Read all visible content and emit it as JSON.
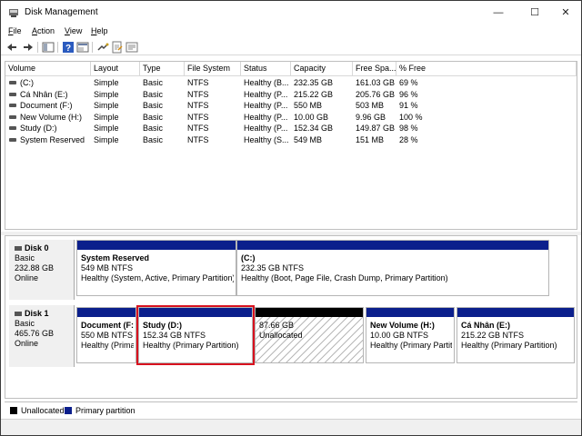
{
  "window": {
    "title": "Disk Management"
  },
  "window_controls": {
    "minimize": "—",
    "maximize": "☐",
    "close": "✕"
  },
  "menu": [
    {
      "underline": "F",
      "rest": "ile"
    },
    {
      "underline": "A",
      "rest": "ction"
    },
    {
      "underline": "V",
      "rest": "iew"
    },
    {
      "underline": "H",
      "rest": "elp"
    }
  ],
  "volumes": {
    "headers": [
      "Volume",
      "Layout",
      "Type",
      "File System",
      "Status",
      "Capacity",
      "Free Spa...",
      "% Free"
    ],
    "rows": [
      [
        "(C:)",
        "Simple",
        "Basic",
        "NTFS",
        "Healthy (B...",
        "232.35 GB",
        "161.03 GB",
        "69 %"
      ],
      [
        "Cá Nhân (E:)",
        "Simple",
        "Basic",
        "NTFS",
        "Healthy (P...",
        "215.22 GB",
        "205.76 GB",
        "96 %"
      ],
      [
        "Document (F:)",
        "Simple",
        "Basic",
        "NTFS",
        "Healthy (P...",
        "550 MB",
        "503 MB",
        "91 %"
      ],
      [
        "New Volume (H:)",
        "Simple",
        "Basic",
        "NTFS",
        "Healthy (P...",
        "10.00 GB",
        "9.96 GB",
        "100 %"
      ],
      [
        "Study (D:)",
        "Simple",
        "Basic",
        "NTFS",
        "Healthy (P...",
        "152.34 GB",
        "149.87 GB",
        "98 %"
      ],
      [
        "System Reserved",
        "Simple",
        "Basic",
        "NTFS",
        "Healthy (S...",
        "549 MB",
        "151 MB",
        "28 %"
      ]
    ]
  },
  "disks": [
    {
      "name": "Disk 0",
      "type": "Basic",
      "size": "232.88 GB",
      "state": "Online",
      "partitions": [
        {
          "name": "System Reserved",
          "size": "549 MB NTFS",
          "status": "Healthy (System, Active, Primary Partition)"
        },
        {
          "name": "(C:)",
          "size": "232.35 GB NTFS",
          "status": "Healthy (Boot, Page File, Crash Dump, Primary Partition)"
        }
      ]
    },
    {
      "name": "Disk 1",
      "type": "Basic",
      "size": "465.76 GB",
      "state": "Online",
      "partitions": [
        {
          "name": "Document  (F:",
          "size": "550 MB NTFS",
          "status": "Healthy (Prima"
        },
        {
          "name": "Study  (D:)",
          "size": "152.34 GB NTFS",
          "status": "Healthy (Primary Partition)"
        },
        {
          "name": "",
          "size": "87.66 GB",
          "status": "Unallocated"
        },
        {
          "name": "New Volume  (H:)",
          "size": "10.00 GB NTFS",
          "status": "Healthy (Primary Partiti"
        },
        {
          "name": "Cá Nhân  (E:)",
          "size": "215.22 GB NTFS",
          "status": "Healthy (Primary Partition)"
        }
      ]
    }
  ],
  "legend": {
    "unallocated": {
      "label": "Unallocated",
      "color": "#000000"
    },
    "primary": {
      "label": "Primary partition",
      "color": "#0b1f8c"
    }
  },
  "colors": {
    "highlight": "#d8121f",
    "primary_bar": "#0b1f8c"
  }
}
